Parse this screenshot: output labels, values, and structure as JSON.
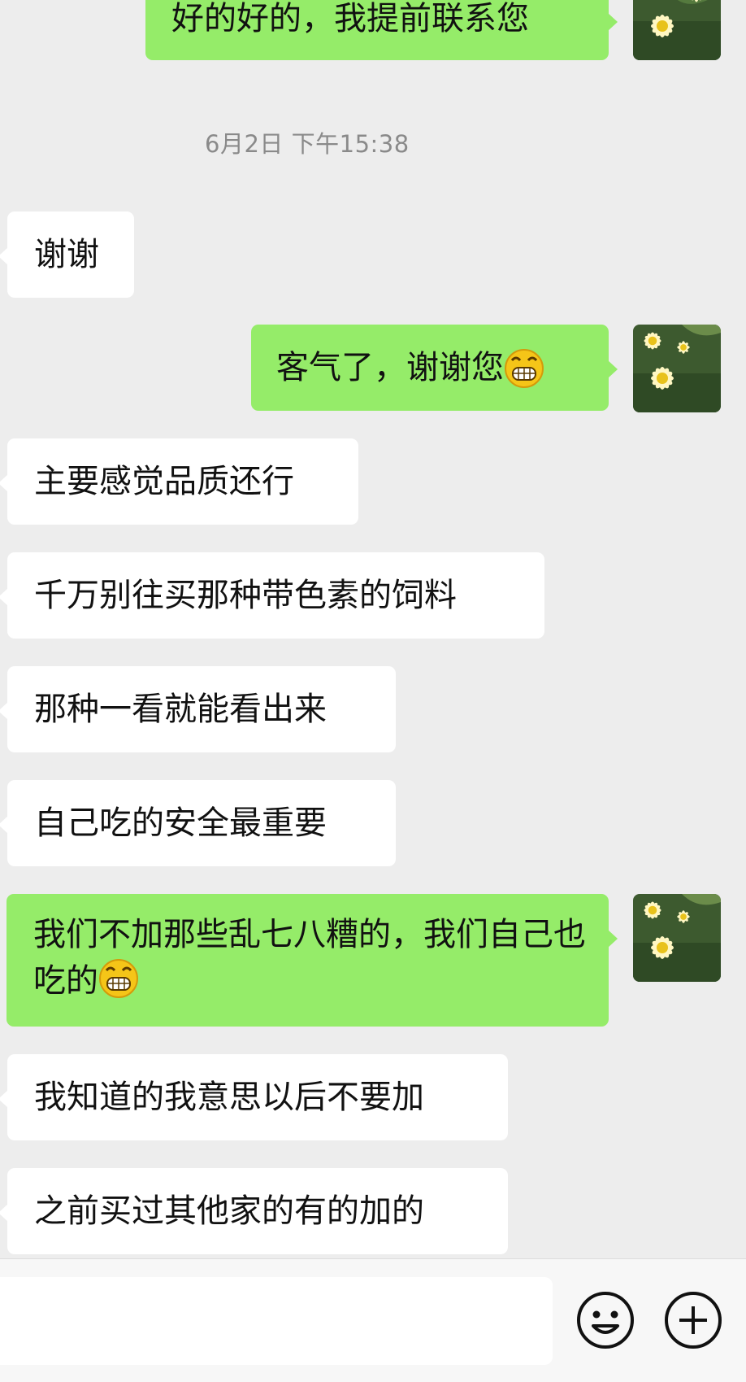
{
  "chat": {
    "timestamp": "6月2日 下午15:38",
    "messages": [
      {
        "side": "right",
        "text": "好的好的，我提前联系您",
        "emoji": null
      },
      {
        "side": "left",
        "text": "谢谢",
        "emoji": null
      },
      {
        "side": "right",
        "text": "客气了，谢谢您",
        "emoji": "grin"
      },
      {
        "side": "left",
        "text": "主要感觉品质还行",
        "emoji": null
      },
      {
        "side": "left",
        "text": "千万别往买那种带色素的饲料",
        "emoji": null
      },
      {
        "side": "left",
        "text": "那种一看就能看出来",
        "emoji": null
      },
      {
        "side": "left",
        "text": "自己吃的安全最重要",
        "emoji": null
      },
      {
        "side": "right",
        "text": "我们不加那些乱七八糟的，我们自己也吃的",
        "emoji": "grin"
      },
      {
        "side": "left",
        "text": "我知道的我意思以后不要加",
        "emoji": null
      },
      {
        "side": "left",
        "text": "之前买过其他家的有的加的",
        "emoji": null
      }
    ]
  },
  "avatar": {
    "icon": "daisy-flower-avatar",
    "colors": {
      "background": "#3d5a2f",
      "petal": "#fff7c2",
      "center": "#e8c21b"
    }
  },
  "input_bar": {
    "placeholder": "",
    "value": "",
    "emoji_button_icon": "smiley-face-icon",
    "plus_button_icon": "plus-circle-icon"
  },
  "colors": {
    "background": "#ededed",
    "bubble_self": "#95ec69",
    "bubble_other": "#ffffff",
    "timestamp": "#8a8a8a"
  }
}
